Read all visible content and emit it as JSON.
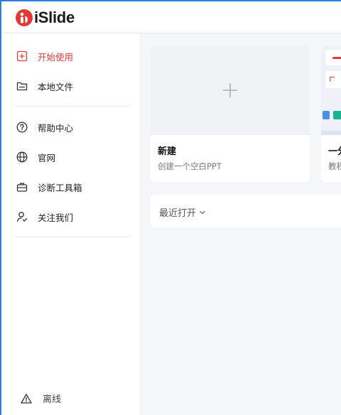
{
  "app": {
    "logo_text": "iSlide",
    "brand_color": "#e53935"
  },
  "sidebar": {
    "items": [
      {
        "label": "开始使用",
        "icon": "plus-square-icon",
        "active": true
      },
      {
        "label": "本地文件",
        "icon": "folder-icon"
      },
      {
        "label": "帮助中心",
        "icon": "question-circle-icon"
      },
      {
        "label": "官网",
        "icon": "globe-icon"
      },
      {
        "label": "诊断工具箱",
        "icon": "toolbox-icon"
      },
      {
        "label": "关注我们",
        "icon": "user-follow-icon"
      }
    ],
    "status_label": "离线",
    "status_icon": "warning-triangle-icon"
  },
  "main": {
    "new_card": {
      "title": "新建",
      "subtitle": "创建一个空白PPT",
      "icon": "plus-icon"
    },
    "tutorial_card": {
      "title": "一分",
      "subtitle": "教程"
    },
    "recent": {
      "label": "最近打开",
      "icon": "chevron-down-icon"
    }
  }
}
